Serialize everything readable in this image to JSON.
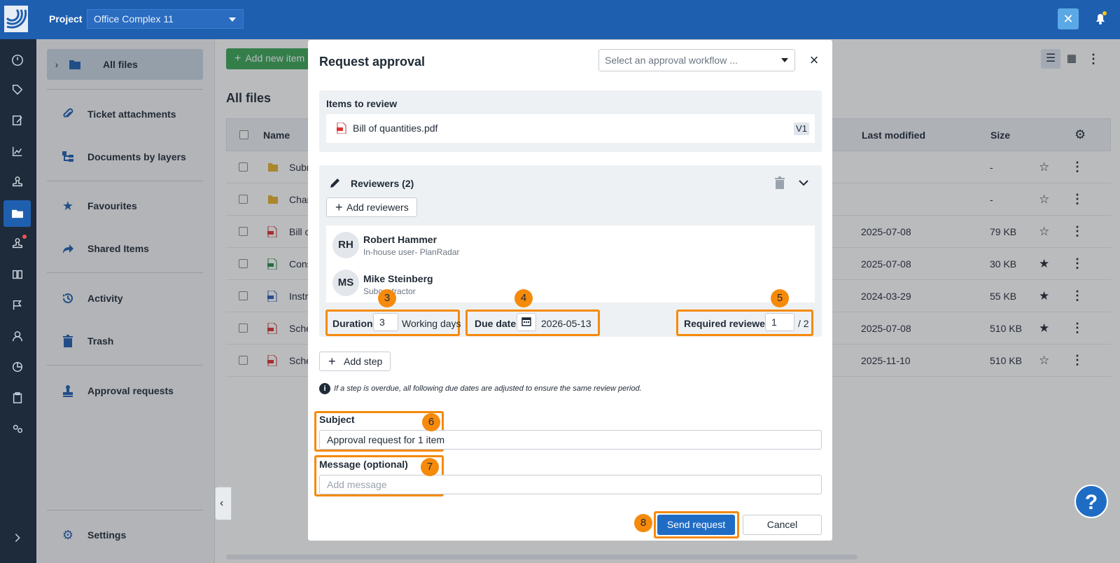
{
  "header": {
    "project_label": "Project",
    "project_value": "Office Complex 11"
  },
  "sidebar": {
    "items": [
      {
        "label": "All files",
        "icon": "folder-icon"
      },
      {
        "label": "Ticket attachments",
        "icon": "paperclip-icon"
      },
      {
        "label": "Documents by layers",
        "icon": "layers-icon"
      },
      {
        "label": "Favourites",
        "icon": "star-icon"
      },
      {
        "label": "Shared Items",
        "icon": "share-icon"
      },
      {
        "label": "Activity",
        "icon": "history-icon"
      },
      {
        "label": "Trash",
        "icon": "trash-icon"
      },
      {
        "label": "Approval requests",
        "icon": "stamp-icon"
      },
      {
        "label": "Settings",
        "icon": "gear-icon"
      }
    ]
  },
  "main": {
    "add_button": "Add new item",
    "title": "All files",
    "columns": {
      "name": "Name",
      "last_modified": "Last modified",
      "size": "Size"
    },
    "rows": [
      {
        "name": "Subr",
        "type": "folder",
        "modified": "",
        "size": "-",
        "fav": false
      },
      {
        "name": "Char",
        "type": "folder",
        "modified": "",
        "size": "-",
        "fav": false
      },
      {
        "name": "Bill c",
        "type": "pdf",
        "modified": "2025-07-08",
        "size": "79 KB",
        "fav": false
      },
      {
        "name": "Cons",
        "type": "xls",
        "modified": "2025-07-08",
        "size": "30 KB",
        "fav": true
      },
      {
        "name": "Instr",
        "type": "doc",
        "modified": "2024-03-29",
        "size": "55 KB",
        "fav": true
      },
      {
        "name": "Sche",
        "type": "pdf",
        "modified": "2025-07-08",
        "size": "510 KB",
        "fav": true
      },
      {
        "name": "Sche",
        "type": "pdf",
        "modified": "2025-11-10",
        "size": "510 KB",
        "fav": false
      }
    ]
  },
  "modal": {
    "title": "Request approval",
    "workflow_placeholder": "Select an approval workflow ...",
    "items_title": "Items to review",
    "item_name": "Bill of quantities.pdf",
    "item_version": "V1",
    "reviewers_title": "Reviewers (2)",
    "add_reviewers": "Add reviewers",
    "reviewers": [
      {
        "initials": "RH",
        "name": "Robert Hammer",
        "role": "In-house user- PlanRadar"
      },
      {
        "initials": "MS",
        "name": "Mike Steinberg",
        "role": "Subcontractor"
      }
    ],
    "duration_label": "Duration",
    "duration_value": "3",
    "duration_unit": "Working days",
    "due_date_label": "Due date",
    "due_date_value": "2026-05-13",
    "required_label": "Required reviewers",
    "required_value": "1",
    "required_total": "/ 2",
    "add_step": "Add step",
    "info_text": "If a step is overdue, all following due dates are adjusted to ensure the same review period.",
    "subject_label": "Subject",
    "subject_value": "Approval request for 1 item",
    "message_label": "Message (optional)",
    "message_placeholder": "Add message",
    "send_label": "Send request",
    "cancel_label": "Cancel"
  },
  "badges": [
    "3",
    "4",
    "5",
    "6",
    "7",
    "8"
  ],
  "colors": {
    "brand": "#1f5fb0",
    "highlight": "#f58a0b",
    "primary_button": "#1f6cc5",
    "add_button": "#3aa556"
  }
}
